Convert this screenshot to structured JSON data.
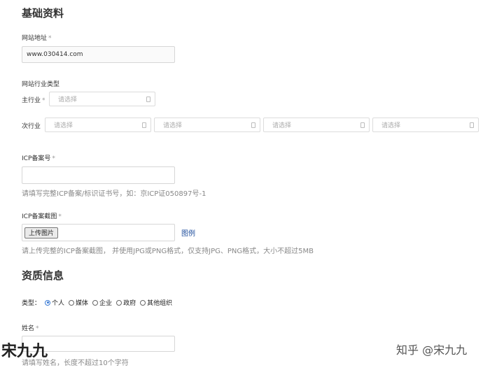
{
  "basic": {
    "title": "基础资料",
    "website": {
      "label": "网站地址",
      "required": "*",
      "value": "www.030414.com"
    },
    "industry": {
      "label": "网站行业类型",
      "main_label": "主行业",
      "main_required": "*",
      "main_placeholder": "请选择",
      "sub_label": "次行业",
      "sub_placeholders": [
        "请选择",
        "请选择",
        "请选择",
        "请选择"
      ]
    },
    "icp": {
      "label": "ICP备案号",
      "required": "*",
      "value": "",
      "hint": "请填写完整ICP备案/标识证书号，如：京ICP证050897号-1"
    },
    "icp_screenshot": {
      "label": "ICP备案截图",
      "required": "*",
      "upload_label": "上传图片",
      "example_link": "图例",
      "hint": "请上传完整的ICP备案截图， 并使用JPG或PNG格式，仅支持JPG、PNG格式，大小不超过5MB"
    }
  },
  "qualification": {
    "title": "资质信息",
    "type_label": "类型：",
    "options": [
      "个人",
      "媒体",
      "企业",
      "政府",
      "其他组织"
    ],
    "selected_index": 0,
    "name": {
      "label": "姓名",
      "required": "*",
      "value": "",
      "hint": "请填写姓名，长度不超过10个字符"
    }
  },
  "watermarks": {
    "left": "宋九九",
    "right": "知乎 @宋九九"
  },
  "colors": {
    "accent": "#3a7bd5",
    "link": "#1f4e9c"
  }
}
